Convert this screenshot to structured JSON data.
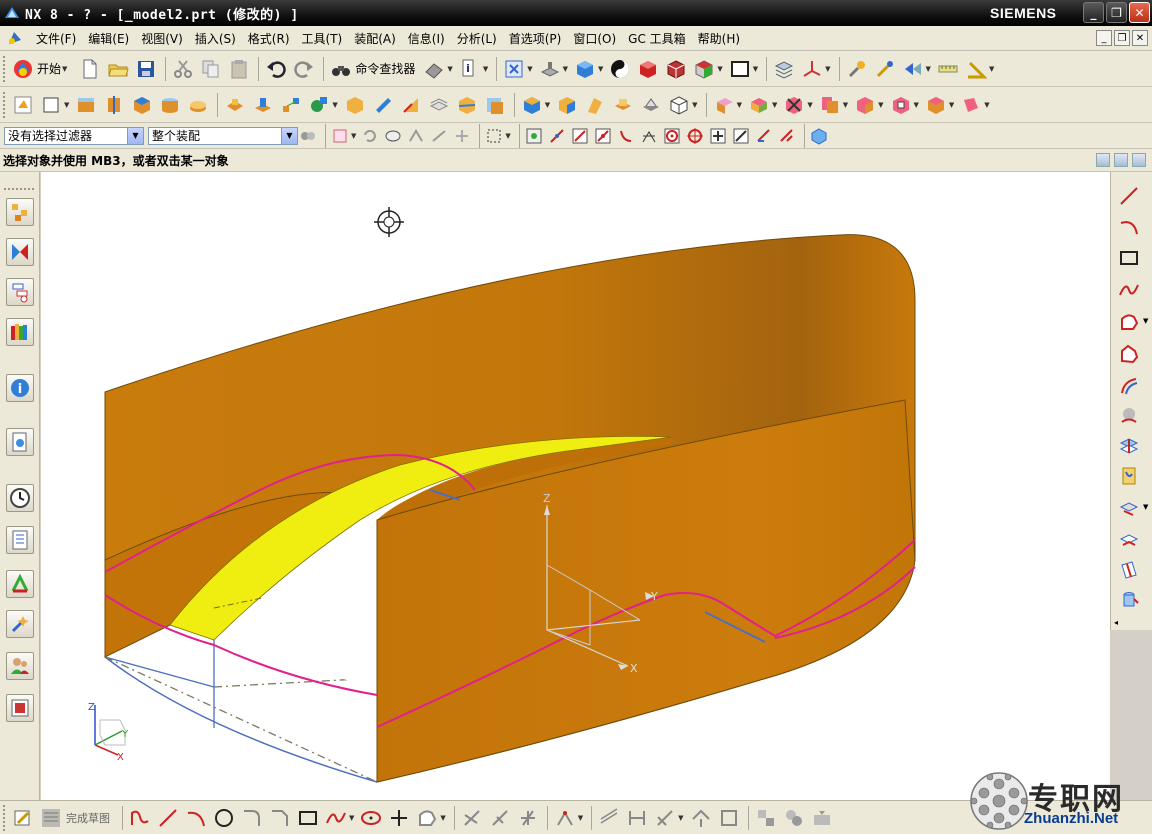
{
  "titlebar": {
    "title": "NX 8 - ? - [_model2.prt  (修改的) ]",
    "brand": "SIEMENS",
    "min": "_",
    "max": "❐",
    "close": "✕"
  },
  "menubar": {
    "items": [
      "文件(F)",
      "编辑(E)",
      "视图(V)",
      "插入(S)",
      "格式(R)",
      "工具(T)",
      "装配(A)",
      "信息(I)",
      "分析(L)",
      "首选项(P)",
      "窗口(O)",
      "GC 工具箱",
      "帮助(H)"
    ]
  },
  "toolbar1": {
    "start_label": "开始",
    "command_finder_label": "命令查找器"
  },
  "toolbar3": {
    "filter_value": "没有选择过滤器",
    "scope_value": "整个装配"
  },
  "cueline": {
    "text": "选择对象并使用 MB3，或者双击某一对象"
  },
  "bottombar": {
    "finish_sketch_label": "完成草图"
  },
  "viewport": {
    "axis_labels": {
      "x": "X",
      "y": "Y",
      "z": "Z"
    },
    "triad_labels": {
      "x": "X",
      "y": "Y",
      "z": "Z"
    }
  },
  "watermark": {
    "title": "专职网",
    "url": "Zhuanzhi.Net"
  },
  "colors": {
    "surface_orange": "#c8790b",
    "highlight_yellow": "#f0ee10",
    "curve_magenta": "#e0208c",
    "edge_blue": "#4d6fc0"
  }
}
